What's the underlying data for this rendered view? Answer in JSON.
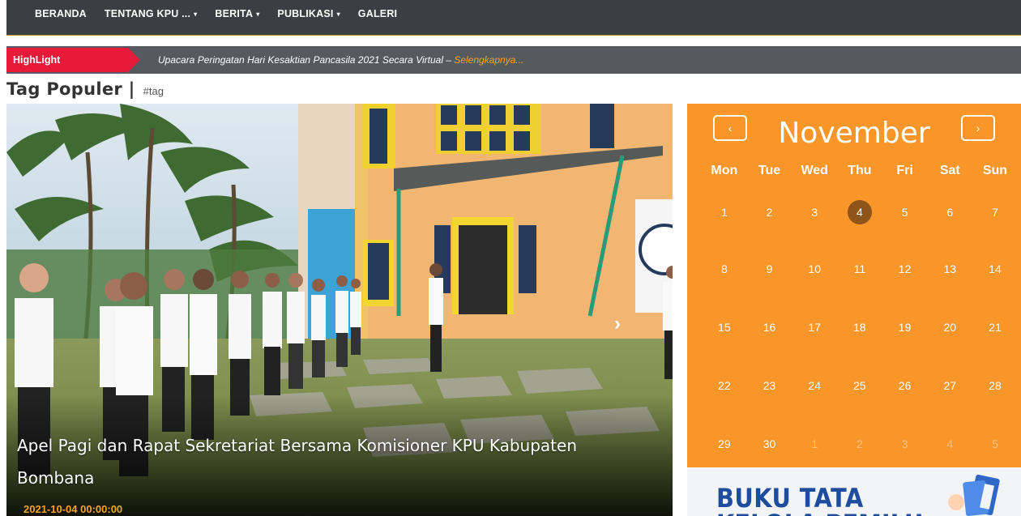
{
  "nav": {
    "items": [
      {
        "label": "BERANDA",
        "dropdown": false
      },
      {
        "label": "TENTANG KPU ...",
        "dropdown": true
      },
      {
        "label": "BERITA",
        "dropdown": true
      },
      {
        "label": "PUBLIKASI",
        "dropdown": true
      },
      {
        "label": "GALERI",
        "dropdown": false
      }
    ],
    "caret": "▾"
  },
  "highlight": {
    "tag": "HighLight",
    "text": "Upacara Peringatan Hari Kesaktian Pancasila 2021 Secara Virtual – ",
    "more": "Selengkapnya..."
  },
  "tags": {
    "title": "Tag Populer |",
    "item": "#tag"
  },
  "slider": {
    "caption": "Apel Pagi dan Rapat Sekretariat Bersama Komisioner KPU Kabupaten Bombana",
    "date": "2021-10-04 00:00:00",
    "next_icon": "›"
  },
  "calendar": {
    "month": "November",
    "prev": "‹",
    "next": "›",
    "weekdays": [
      "Mon",
      "Tue",
      "Wed",
      "Thu",
      "Fri",
      "Sat",
      "Sun"
    ],
    "weeks": [
      [
        "1",
        "2",
        "3",
        "4",
        "5",
        "6",
        "7"
      ],
      [
        "8",
        "9",
        "10",
        "11",
        "12",
        "13",
        "14"
      ],
      [
        "15",
        "16",
        "17",
        "18",
        "19",
        "20",
        "21"
      ],
      [
        "22",
        "23",
        "24",
        "25",
        "26",
        "27",
        "28"
      ],
      [
        "29",
        "30",
        "1",
        "2",
        "3",
        "4",
        "5"
      ]
    ],
    "today": "4",
    "colors": {
      "bg": "#f9962a",
      "today": "#8f541a"
    }
  },
  "banner": {
    "line1": "BUKU TATA",
    "line2": "KELOLA PEMILU"
  },
  "colors": {
    "nav_bg": "#3a3f44",
    "highlight_red": "#e81a3a",
    "accent_orange": "#f6a421"
  }
}
